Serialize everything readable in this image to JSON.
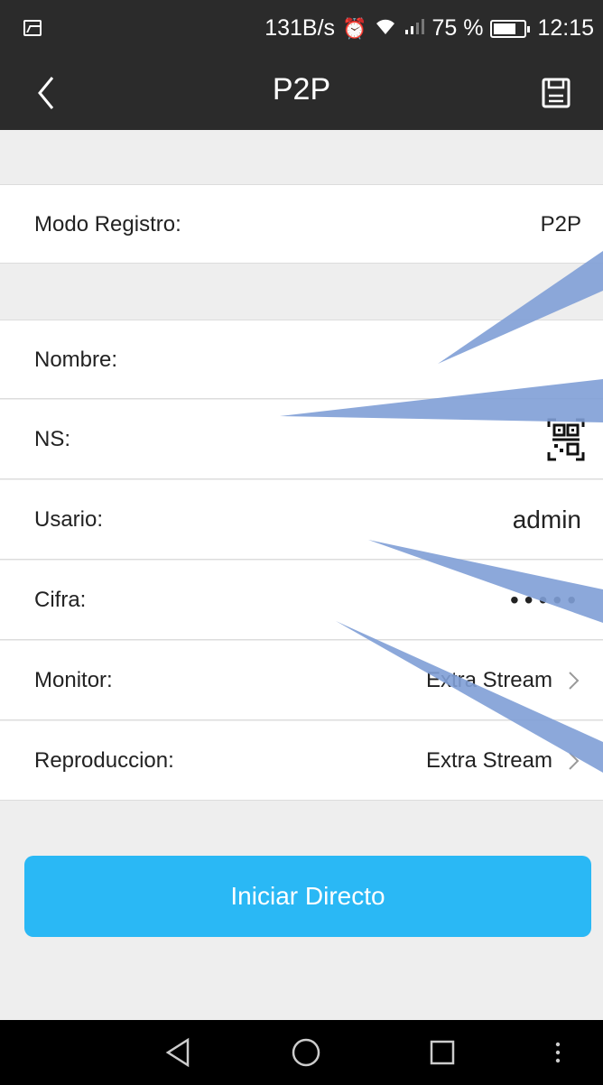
{
  "status_bar": {
    "speed": "131B/s",
    "battery_percent": "75 %",
    "battery_level": 0.75,
    "time": "12:15",
    "icons": [
      "image-icon",
      "alarm-icon",
      "wifi-icon",
      "signal-icon",
      "battery-icon"
    ]
  },
  "app_bar": {
    "title": "P2P",
    "back_icon": "chevron-left-icon",
    "save_icon": "save-icon"
  },
  "form": {
    "mode": {
      "label": "Modo Registro:",
      "value": "P2P"
    },
    "name": {
      "label": "Nombre:",
      "value": ""
    },
    "serial": {
      "label": "NS:",
      "value": "",
      "icon": "qr-scan-icon"
    },
    "user": {
      "label": "Usario:",
      "value": "admin"
    },
    "password": {
      "label": "Cifra:",
      "value": "•••••"
    },
    "monitor": {
      "label": "Monitor:",
      "value": "Extra Stream"
    },
    "playback": {
      "label": "Reproduccion:",
      "value": "Extra Stream"
    }
  },
  "actions": {
    "start_live": "Iniciar Directo"
  },
  "colors": {
    "bar": "#2b2b2b",
    "accent": "#2ab8f5",
    "callout": "#7f9fd6"
  },
  "nav_bar": {
    "icons": [
      "back-triangle-icon",
      "home-circle-icon",
      "recents-square-icon",
      "menu-dots-icon"
    ]
  }
}
